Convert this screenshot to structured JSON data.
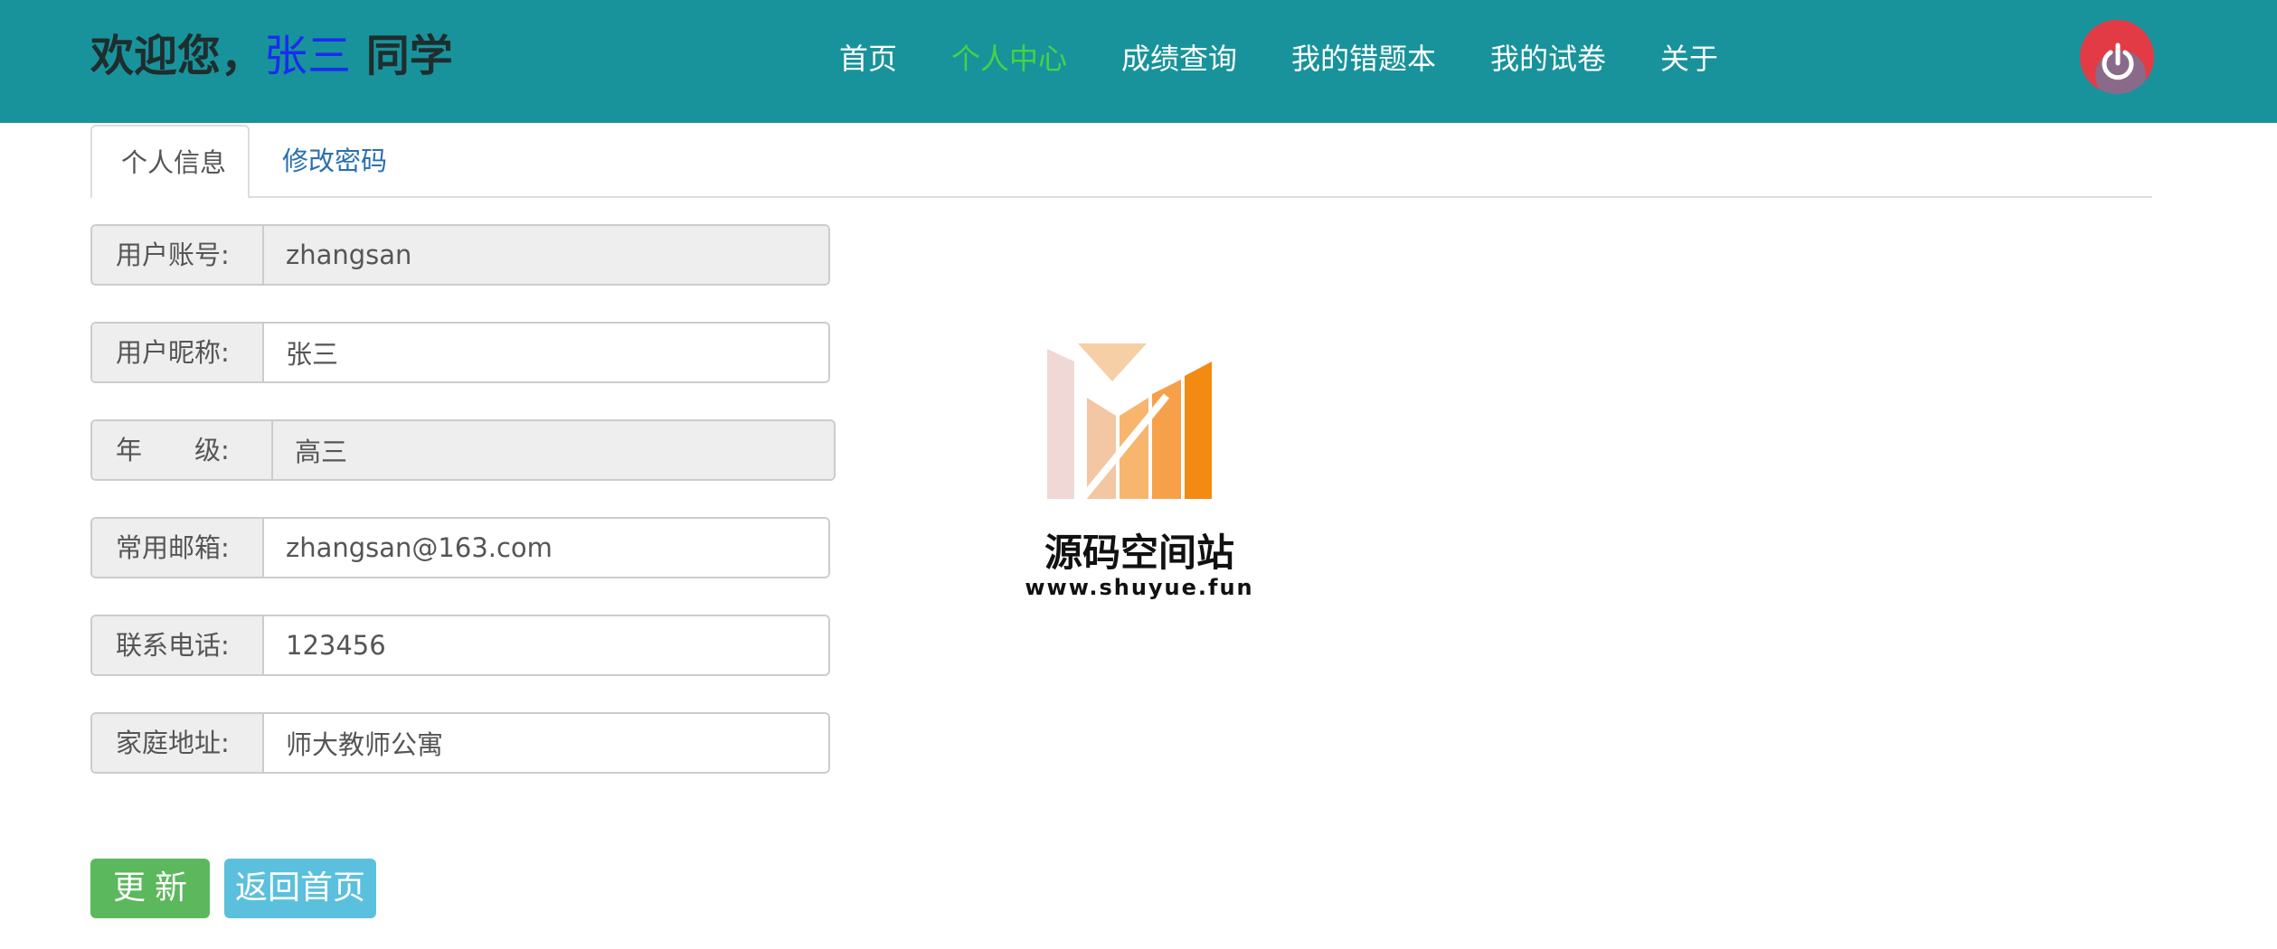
{
  "header": {
    "welcome_prefix": "欢迎您，",
    "username": "张三",
    "welcome_suffix": " 同学",
    "nav": [
      {
        "label": "首页",
        "active": false
      },
      {
        "label": "个人中心",
        "active": true
      },
      {
        "label": "成绩查询",
        "active": false
      },
      {
        "label": "我的错题本",
        "active": false
      },
      {
        "label": "我的试卷",
        "active": false
      },
      {
        "label": "关于",
        "active": false
      }
    ],
    "power_icon": "power-icon"
  },
  "tabs": [
    {
      "label": "个人信息",
      "active": true
    },
    {
      "label": "修改密码",
      "active": false
    }
  ],
  "form": {
    "account": {
      "label": "用户账号:",
      "value": "zhangsan"
    },
    "nickname": {
      "label": "用户昵称:",
      "value": "张三"
    },
    "grade": {
      "label": "年　　级:",
      "value": "高三"
    },
    "email": {
      "label": "常用邮箱:",
      "value": "zhangsan@163.com"
    },
    "phone": {
      "label": "联系电话:",
      "value": "123456"
    },
    "address": {
      "label": "家庭地址:",
      "value": "师大教师公寓"
    }
  },
  "buttons": {
    "update": "更新",
    "back": "返回首页"
  },
  "watermark": {
    "name": "源码空间站",
    "url": "www.shuyue.fun"
  },
  "colors": {
    "header_bg": "#18939b",
    "nav_active": "#46d246",
    "username": "#1a2cf0",
    "update_button": "#5cb85c",
    "back_button": "#5bc0de"
  }
}
